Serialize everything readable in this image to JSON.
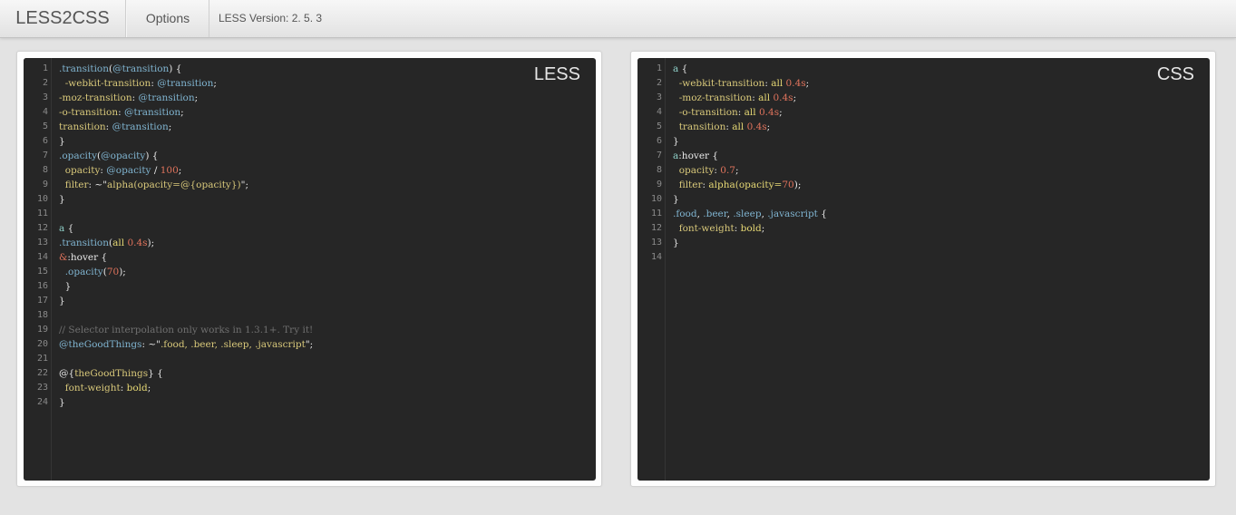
{
  "navbar": {
    "brand": "LESS2CSS",
    "options": "Options",
    "version": "LESS Version: 2. 5. 3"
  },
  "editors": {
    "less": {
      "label": "LESS",
      "lines": [
        [
          [
            ".transition",
            "mx"
          ],
          [
            "(",
            "pl"
          ],
          [
            "@transition",
            "vr"
          ],
          [
            ") {",
            "pl"
          ]
        ],
        [
          [
            "  ",
            "pl"
          ],
          [
            "-webkit-transition",
            "pr"
          ],
          [
            ": ",
            "pl"
          ],
          [
            "@transition",
            "vr"
          ],
          [
            ";",
            "pl"
          ]
        ],
        [
          [
            "-moz-transition",
            "pr"
          ],
          [
            ": ",
            "pl"
          ],
          [
            "@transition",
            "vr"
          ],
          [
            ";",
            "pl"
          ]
        ],
        [
          [
            "-o-transition",
            "pr"
          ],
          [
            ": ",
            "pl"
          ],
          [
            "@transition",
            "vr"
          ],
          [
            ";",
            "pl"
          ]
        ],
        [
          [
            "transition",
            "pr"
          ],
          [
            ": ",
            "pl"
          ],
          [
            "@transition",
            "vr"
          ],
          [
            ";",
            "pl"
          ]
        ],
        [
          [
            "}",
            "pl"
          ]
        ],
        [
          [
            ".opacity",
            "mx"
          ],
          [
            "(",
            "pl"
          ],
          [
            "@opacity",
            "vr"
          ],
          [
            ") {",
            "pl"
          ]
        ],
        [
          [
            "  ",
            "pl"
          ],
          [
            "opacity",
            "pr"
          ],
          [
            ": ",
            "pl"
          ],
          [
            "@opacity",
            "vr"
          ],
          [
            " / ",
            "pl"
          ],
          [
            "100",
            "nm"
          ],
          [
            ";",
            "pl"
          ]
        ],
        [
          [
            "  ",
            "pl"
          ],
          [
            "filter",
            "pr"
          ],
          [
            ": ~\"",
            "pl"
          ],
          [
            "alpha(opacity=@{opacity})",
            "st"
          ],
          [
            "\";",
            "pl"
          ]
        ],
        [
          [
            "}",
            "pl"
          ]
        ],
        [],
        [
          [
            "a",
            "tg"
          ],
          [
            " {",
            "pl"
          ]
        ],
        [
          [
            ".transition",
            "mx"
          ],
          [
            "(",
            "pl"
          ],
          [
            "all",
            "kw"
          ],
          [
            " ",
            "pl"
          ],
          [
            "0.4s",
            "nm"
          ],
          [
            ");",
            "pl"
          ]
        ],
        [
          [
            "&",
            "nm"
          ],
          [
            ":hover {",
            "pl"
          ]
        ],
        [
          [
            "  ",
            "pl"
          ],
          [
            ".opacity",
            "mx"
          ],
          [
            "(",
            "pl"
          ],
          [
            "70",
            "nm"
          ],
          [
            ");",
            "pl"
          ]
        ],
        [
          [
            "  }",
            "pl"
          ]
        ],
        [
          [
            "}",
            "pl"
          ]
        ],
        [],
        [
          [
            "// Selector interpolation only works in 1.3.1+. Try it!",
            "cm"
          ]
        ],
        [
          [
            "@theGoodThings",
            "vr"
          ],
          [
            ": ~\"",
            "pl"
          ],
          [
            ".food, .beer, .sleep, .javascript",
            "st"
          ],
          [
            "\";",
            "pl"
          ]
        ],
        [],
        [
          [
            "@{",
            "pl"
          ],
          [
            "theGoodThings",
            "st"
          ],
          [
            "} {",
            "pl"
          ]
        ],
        [
          [
            "  ",
            "pl"
          ],
          [
            "font-weight",
            "pr"
          ],
          [
            ": ",
            "pl"
          ],
          [
            "bold",
            "kw"
          ],
          [
            ";",
            "pl"
          ]
        ],
        [
          [
            "}",
            "pl"
          ]
        ]
      ]
    },
    "css": {
      "label": "CSS",
      "lines": [
        [
          [
            "a",
            "tg"
          ],
          [
            " {",
            "pl"
          ]
        ],
        [
          [
            "  ",
            "pl"
          ],
          [
            "-webkit-transition",
            "pr"
          ],
          [
            ": ",
            "pl"
          ],
          [
            "all",
            "kw"
          ],
          [
            " ",
            "pl"
          ],
          [
            "0.4s",
            "nm"
          ],
          [
            ";",
            "pl"
          ]
        ],
        [
          [
            "  ",
            "pl"
          ],
          [
            "-moz-transition",
            "pr"
          ],
          [
            ": ",
            "pl"
          ],
          [
            "all",
            "kw"
          ],
          [
            " ",
            "pl"
          ],
          [
            "0.4s",
            "nm"
          ],
          [
            ";",
            "pl"
          ]
        ],
        [
          [
            "  ",
            "pl"
          ],
          [
            "-o-transition",
            "pr"
          ],
          [
            ": ",
            "pl"
          ],
          [
            "all",
            "kw"
          ],
          [
            " ",
            "pl"
          ],
          [
            "0.4s",
            "nm"
          ],
          [
            ";",
            "pl"
          ]
        ],
        [
          [
            "  ",
            "pl"
          ],
          [
            "transition",
            "pr"
          ],
          [
            ": ",
            "pl"
          ],
          [
            "all",
            "kw"
          ],
          [
            " ",
            "pl"
          ],
          [
            "0.4s",
            "nm"
          ],
          [
            ";",
            "pl"
          ]
        ],
        [
          [
            "}",
            "pl"
          ]
        ],
        [
          [
            "a",
            "tg"
          ],
          [
            ":hover {",
            "pl"
          ]
        ],
        [
          [
            "  ",
            "pl"
          ],
          [
            "opacity",
            "pr"
          ],
          [
            ": ",
            "pl"
          ],
          [
            "0.7",
            "nm"
          ],
          [
            ";",
            "pl"
          ]
        ],
        [
          [
            "  ",
            "pl"
          ],
          [
            "filter",
            "pr"
          ],
          [
            ": ",
            "pl"
          ],
          [
            "alpha(opacity=",
            "kw"
          ],
          [
            "70",
            "nm"
          ],
          [
            ");",
            "pl"
          ]
        ],
        [
          [
            "}",
            "pl"
          ]
        ],
        [
          [
            ".food",
            "mx"
          ],
          [
            ", ",
            "pl"
          ],
          [
            ".beer",
            "mx"
          ],
          [
            ", ",
            "pl"
          ],
          [
            ".sleep",
            "mx"
          ],
          [
            ", ",
            "pl"
          ],
          [
            ".javascript",
            "mx"
          ],
          [
            " {",
            "pl"
          ]
        ],
        [
          [
            "  ",
            "pl"
          ],
          [
            "font-weight",
            "pr"
          ],
          [
            ": ",
            "pl"
          ],
          [
            "bold",
            "kw"
          ],
          [
            ";",
            "pl"
          ]
        ],
        [
          [
            "}",
            "pl"
          ]
        ],
        []
      ]
    }
  }
}
